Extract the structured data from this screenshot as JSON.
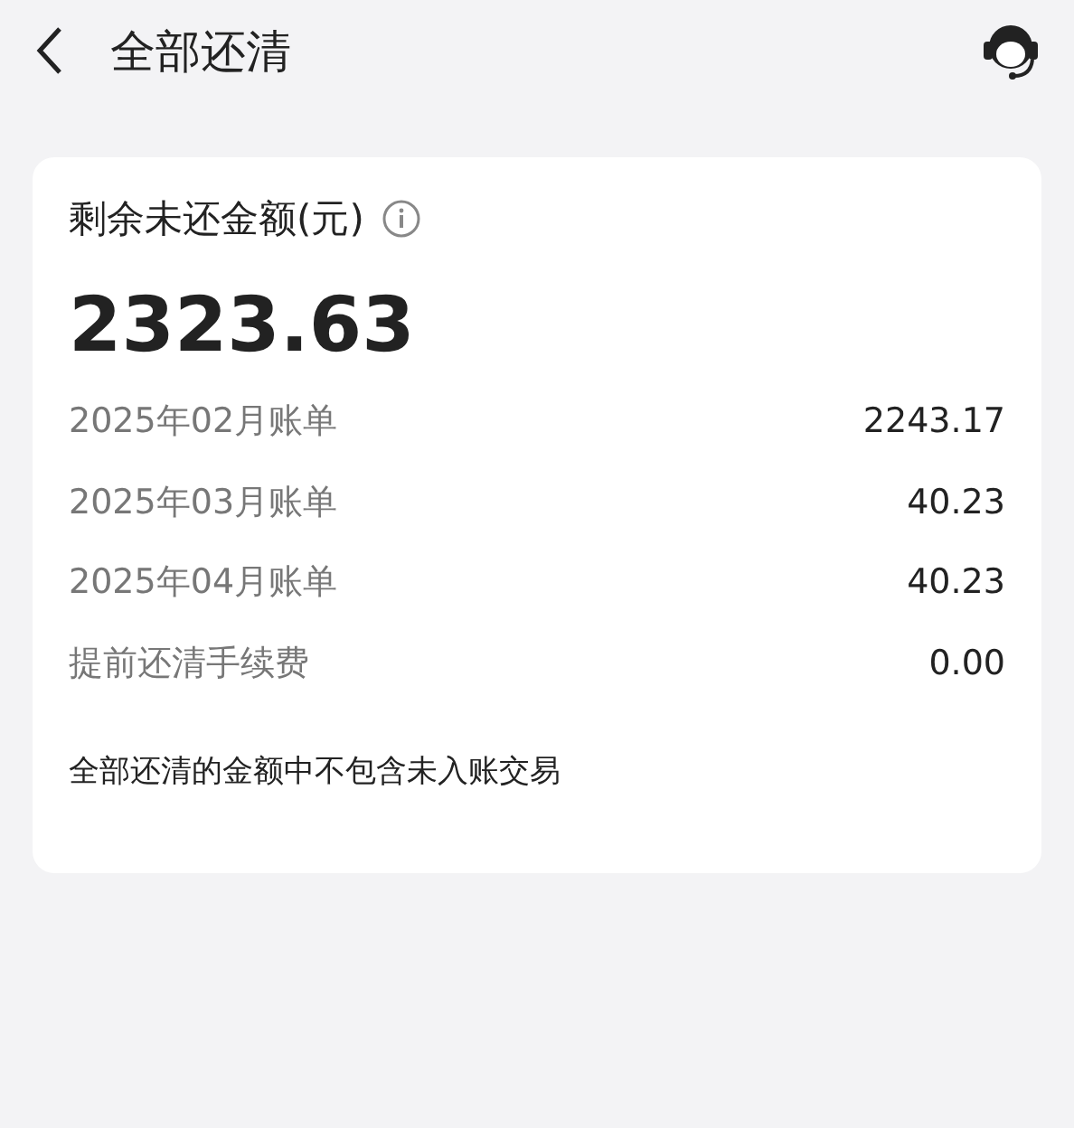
{
  "header": {
    "title": "全部还清"
  },
  "card": {
    "label": "剩余未还金额(元)",
    "amount": "2323.63",
    "rows": [
      {
        "label": "2025年02月账单",
        "value": "2243.17"
      },
      {
        "label": "2025年03月账单",
        "value": "40.23"
      },
      {
        "label": "2025年04月账单",
        "value": "40.23"
      },
      {
        "label": "提前还清手续费",
        "value": "0.00"
      }
    ],
    "note": "全部还清的金额中不包含未入账交易"
  }
}
